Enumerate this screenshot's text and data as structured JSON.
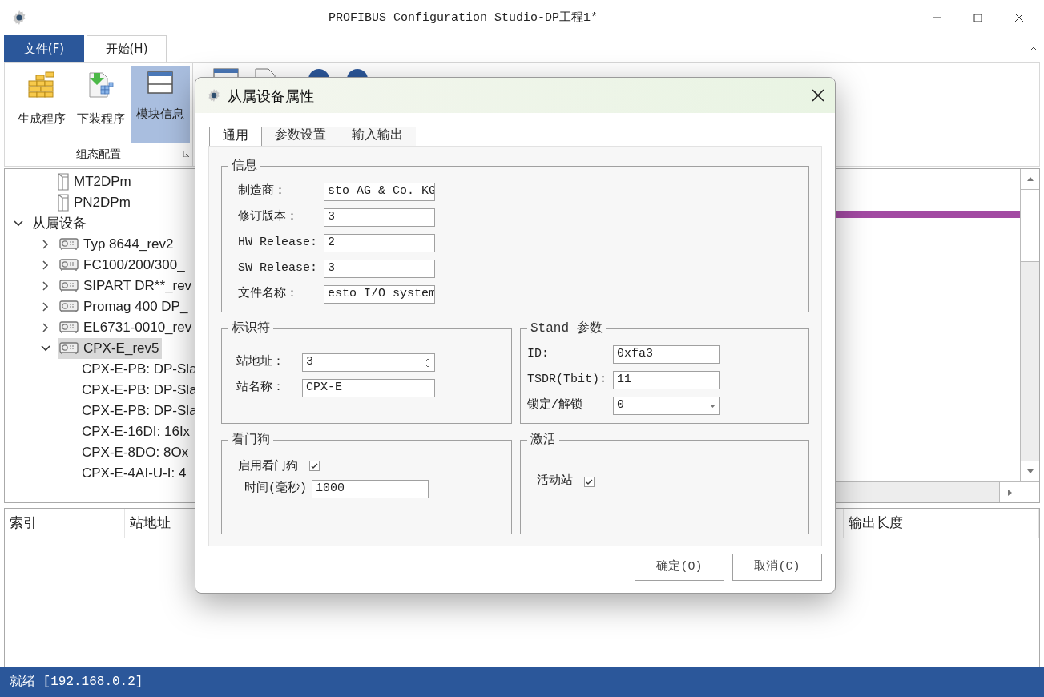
{
  "window": {
    "title": "PROFIBUS Configuration Studio-DP工程1*"
  },
  "ribbon": {
    "tabs": [
      {
        "label": "文件(F)",
        "kind": "file",
        "selected": false
      },
      {
        "label": "开始(H)",
        "kind": "tab",
        "selected": true
      }
    ],
    "buttons": [
      {
        "label": "生成程序",
        "selected": false
      },
      {
        "label": "下装程序",
        "selected": false
      },
      {
        "label": "模块信息",
        "selected": true
      }
    ],
    "group_label": "组态配置"
  },
  "tree": {
    "items": [
      {
        "label": "MT2DPm",
        "kind": "page"
      },
      {
        "label": "PN2DPm",
        "kind": "page"
      },
      {
        "label": "从属设备",
        "kind": "folder",
        "expanded": true,
        "children": [
          {
            "label": "Typ 8644_rev2",
            "kind": "device",
            "expanded": false,
            "selected": false
          },
          {
            "label": "FC100/200/300_",
            "kind": "device",
            "expanded": false,
            "selected": false
          },
          {
            "label": "SIPART DR**_rev",
            "kind": "device",
            "expanded": false,
            "selected": false
          },
          {
            "label": "Promag 400 DP_",
            "kind": "device",
            "expanded": false,
            "selected": false
          },
          {
            "label": "EL6731-0010_rev",
            "kind": "device",
            "expanded": false,
            "selected": false
          },
          {
            "label": "CPX-E_rev5",
            "kind": "device",
            "expanded": true,
            "selected": true,
            "children": [
              {
                "label": "CPX-E-PB: DP-Sla",
                "kind": "module"
              },
              {
                "label": "CPX-E-PB: DP-Sla",
                "kind": "module"
              },
              {
                "label": "CPX-E-PB: DP-Sla",
                "kind": "module"
              },
              {
                "label": "CPX-E-16DI: 16Ix",
                "kind": "module"
              },
              {
                "label": "CPX-E-8DO: 8Ox",
                "kind": "module"
              },
              {
                "label": "CPX-E-4AI-U-I: 4",
                "kind": "module"
              }
            ]
          }
        ]
      }
    ]
  },
  "table": {
    "columns": [
      "索引",
      "站地址",
      "输出长度"
    ]
  },
  "status_bar": "就绪 [192.168.0.2]",
  "dialog": {
    "title": "从属设备属性",
    "tabs": [
      {
        "label": "通用",
        "selected": true
      },
      {
        "label": "参数设置",
        "selected": false
      },
      {
        "label": "输入输出",
        "selected": false
      }
    ],
    "info": {
      "title": "信息",
      "fields": [
        {
          "label": "制造商：",
          "value": "sto AG & Co. KG"
        },
        {
          "label": "修订版本：",
          "value": "3"
        },
        {
          "label": "HW Release:",
          "value": "2"
        },
        {
          "label": "SW Release:",
          "value": "3"
        },
        {
          "label": "文件名称：",
          "value": "esto I/O system"
        }
      ]
    },
    "identifier": {
      "title": "标识符",
      "fields": [
        {
          "label": "站地址：",
          "value": "3",
          "kind": "spin"
        },
        {
          "label": "站名称：",
          "value": "CPX-E",
          "kind": "text"
        }
      ]
    },
    "stand": {
      "title": "Stand 参数",
      "fields": [
        {
          "label": "ID:",
          "value": "0xfa3",
          "kind": "text"
        },
        {
          "label": "TSDR(Tbit):",
          "value": "11",
          "kind": "text"
        },
        {
          "label": "锁定/解锁",
          "value": "0",
          "kind": "select"
        }
      ]
    },
    "watchdog": {
      "title": "看门狗",
      "enable": {
        "label": "启用看门狗",
        "checked": true
      },
      "time": {
        "label": "时间(毫秒)",
        "value": "1000"
      }
    },
    "activate": {
      "title": "激活",
      "station": {
        "label": "活动站",
        "checked": true
      }
    },
    "buttons": [
      "确定(O)",
      "取消(C)"
    ]
  }
}
